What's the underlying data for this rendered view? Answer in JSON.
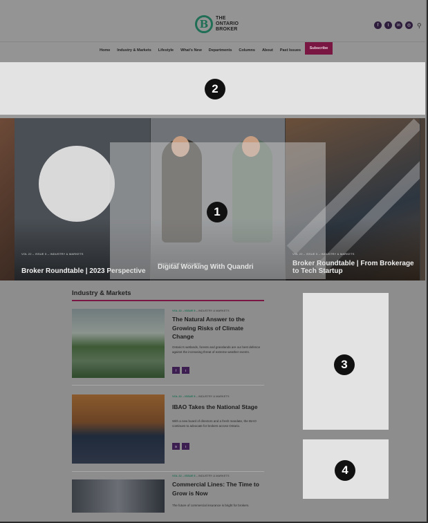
{
  "header": {
    "logo_mark": "B",
    "logo_line1": "THE",
    "logo_line2": "ONTARIO",
    "logo_line3": "BROKER",
    "social_icons": [
      "facebook-icon",
      "twitter-icon",
      "linkedin-icon",
      "instagram-icon"
    ],
    "search_icon": "search-icon"
  },
  "nav": {
    "items": [
      "Home",
      "Industry & Markets",
      "Lifestyle",
      "What's New",
      "Departments",
      "Columns",
      "About",
      "Past Issues"
    ],
    "subscribe_label": "Subscribe",
    "accent_color": "#7a1642"
  },
  "badges": [
    "1",
    "2",
    "3",
    "4"
  ],
  "slider": {
    "slides": [
      {
        "meta": "VOL 22 – ISSUE 5 – INDUSTRY & MARKETS",
        "title": "Broker Roundtable | 2023 Perspective"
      },
      {
        "meta": "VOL 22 – ISSUE 5 – COLUMNS",
        "title": "Digital Working With Quandri"
      },
      {
        "meta": "VOL 22 – ISSUE 5 – INDUSTRY & MARKETS",
        "title": "Broker Roundtable | From Brokerage to Tech Startup"
      }
    ]
  },
  "section": {
    "title": "Industry & Markets"
  },
  "articles": [
    {
      "category": "VOL 22 – ISSUE 5",
      "date": "– INDUSTRY & MARKETS",
      "title": "The Natural Answer to the Growing Risks of Climate Change",
      "excerpt": "Ontario's wetlands, forests and grasslands are our best defence against the increasing threat of extreme weather events.",
      "tags": [
        "f",
        "t"
      ]
    },
    {
      "category": "VOL 22 – ISSUE 5",
      "date": "– INDUSTRY & MARKETS",
      "title": "IBAO Takes the National Stage",
      "excerpt": "With a new board of directors and a fresh mandate, the IBAO continues to advocate for brokers across Ontario.",
      "tags": [
        "in",
        "t"
      ]
    },
    {
      "category": "VOL 22 – ISSUE 5",
      "date": "– INDUSTRY & MARKETS",
      "title": "Commercial Lines: The Time to Grow is Now",
      "excerpt": "The future of commercial insurance is bright for brokers.",
      "tags": []
    }
  ]
}
